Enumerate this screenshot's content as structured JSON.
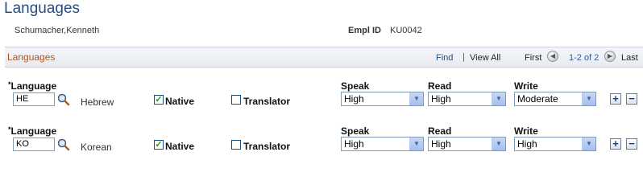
{
  "page": {
    "title": "Languages"
  },
  "employee": {
    "name": "Schumacher,Kenneth",
    "emplid_label": "Empl ID",
    "emplid": "KU0042"
  },
  "grid": {
    "title": "Languages",
    "find": "Find",
    "separator": "|",
    "view_all": "View All",
    "first": "First",
    "range": "1-2 of 2",
    "last": "Last"
  },
  "labels": {
    "language": "Language",
    "native": "Native",
    "translator": "Translator",
    "speak": "Speak",
    "read": "Read",
    "write": "Write"
  },
  "rows": [
    {
      "code": "HE",
      "description": "Hebrew",
      "native": true,
      "translator": false,
      "speak": "High",
      "read": "High",
      "write": "Moderate"
    },
    {
      "code": "KO",
      "description": "Korean",
      "native": true,
      "translator": false,
      "speak": "High",
      "read": "High",
      "write": "High"
    }
  ],
  "colors": {
    "title": "#2c4d84",
    "grid_title": "#b0541a",
    "link": "#1e4a8c",
    "check": "#21a121"
  },
  "icons": {
    "lookup": "magnifier-icon",
    "prev": "arrow-left-icon",
    "next": "arrow-right-icon",
    "add_row": "plus-icon",
    "delete_row": "minus-icon",
    "dropdown": "chevron-down-icon",
    "checkmark": "checkmark-icon"
  }
}
